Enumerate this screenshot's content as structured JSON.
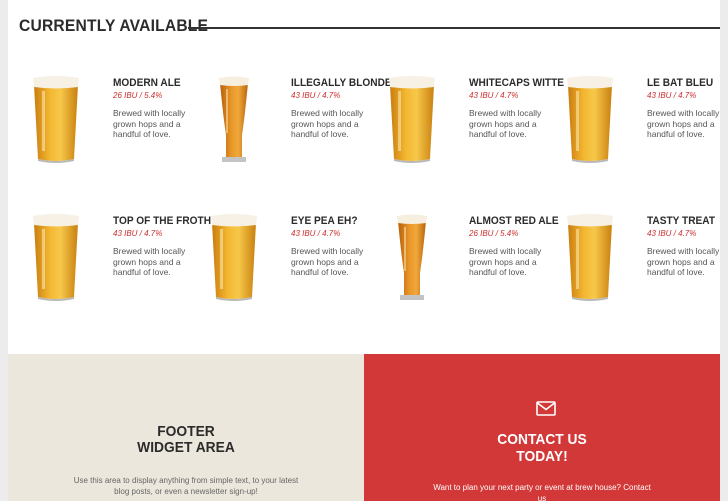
{
  "section": {
    "title": "CURRENTLY AVAILABLE"
  },
  "beers": [
    {
      "name": "MODERN ALE",
      "stats": "26 IBU / 5.4%",
      "description": "Brewed with locally grown hops and a handful of love.",
      "glass_icon": "pint-glass-icon"
    },
    {
      "name": "ILLEGALLY BLONDE",
      "stats": "43 IBU / 4.7%",
      "description": "Brewed with locally grown hops and a handful of love.",
      "glass_icon": "tall-glass-icon"
    },
    {
      "name": "WHITECAPS WITTE",
      "stats": "43 IBU / 4.7%",
      "description": "Brewed with locally grown hops and a handful of love.",
      "glass_icon": "pint-glass-icon"
    },
    {
      "name": "LE BAT BLEU",
      "stats": "43 IBU / 4.7%",
      "description": "Brewed with locally grown hops and a handful of love.",
      "glass_icon": "pint-glass-icon"
    },
    {
      "name": "TOP OF THE FROTH",
      "stats": "43 IBU / 4.7%",
      "description": "Brewed with locally grown hops and a handful of love.",
      "glass_icon": "pint-glass-icon"
    },
    {
      "name": "EYE PEA EH?",
      "stats": "43 IBU / 4.7%",
      "description": "Brewed with locally grown hops and a handful of love.",
      "glass_icon": "pint-glass-icon"
    },
    {
      "name": "ALMOST RED ALE",
      "stats": "26 IBU / 5.4%",
      "description": "Brewed with locally grown hops and a handful of love.",
      "glass_icon": "tall-glass-icon"
    },
    {
      "name": "TASTY TREAT",
      "stats": "43 IBU / 4.7%",
      "description": "Brewed with locally grown hops and a handful of love.",
      "glass_icon": "pint-glass-icon"
    }
  ],
  "footer_widget": {
    "title_line1": "FOOTER",
    "title_line2": "WIDGET AREA",
    "text": "Use this area to display anything from simple text, to your latest blog posts, or even a newsletter sign-up!"
  },
  "contact": {
    "icon": "envelope-icon",
    "title_line1": "CONTACT US",
    "title_line2": "TODAY!",
    "text": "Want to plan your next party or event at brew house? Contact us"
  },
  "colors": {
    "accent": "#d33838",
    "beige": "#ece7dc",
    "beer_gold": "#e8a21f"
  }
}
